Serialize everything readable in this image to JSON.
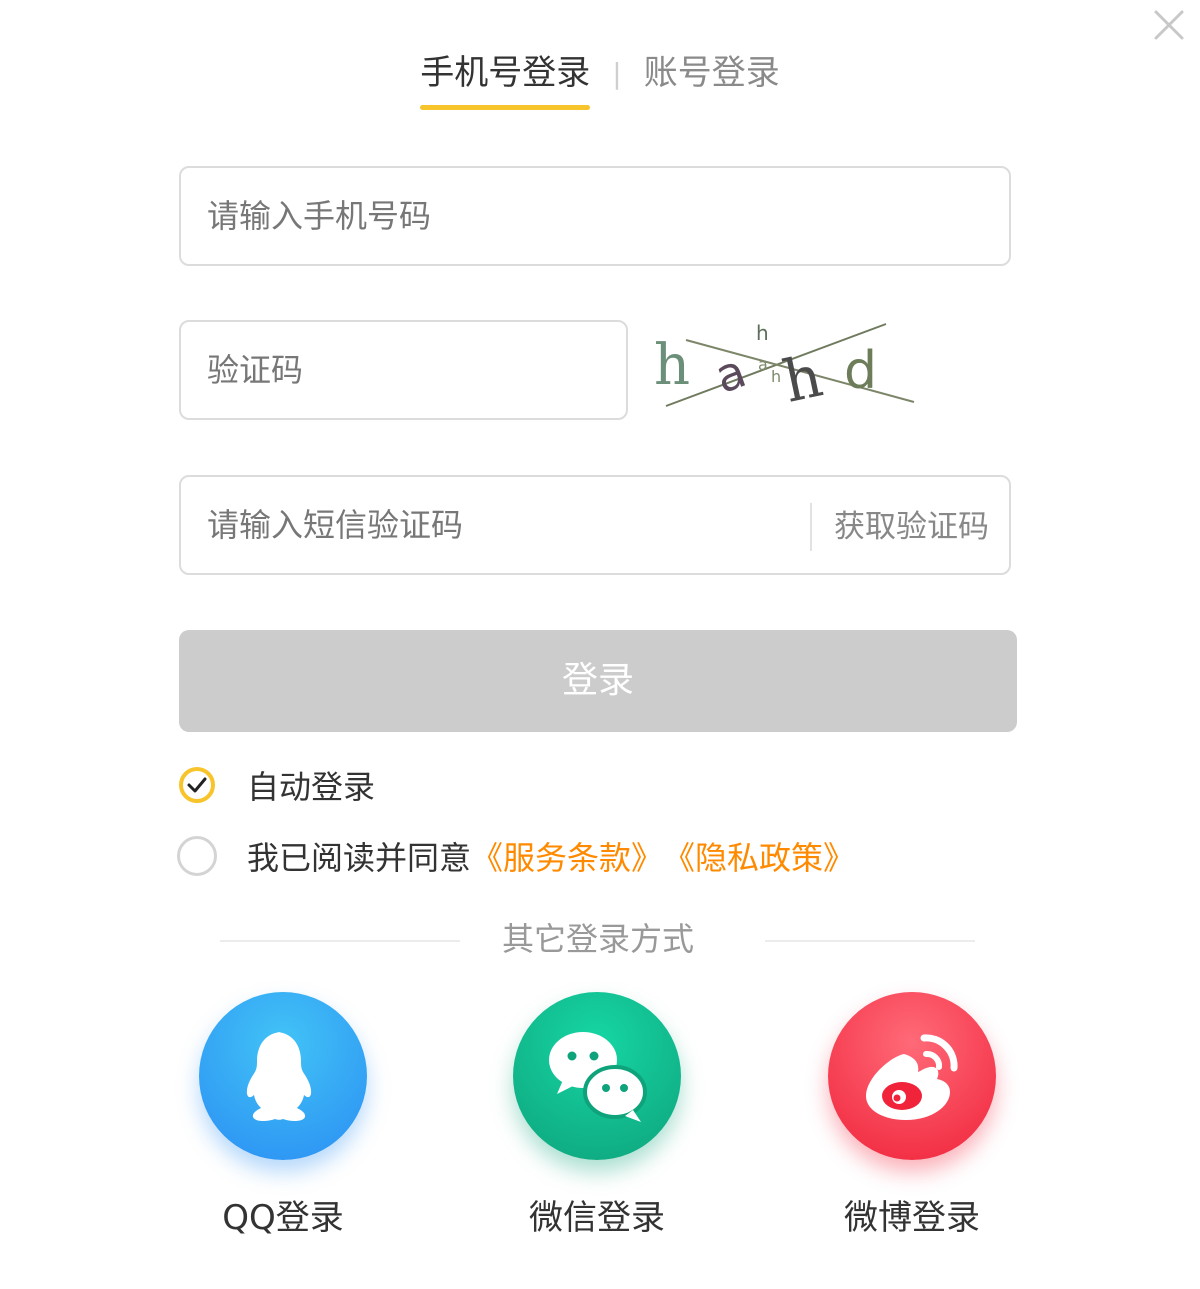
{
  "tabs": [
    {
      "label": "手机号登录",
      "active": true
    },
    {
      "label": "账号登录",
      "active": false
    }
  ],
  "tab_separator": "|",
  "form": {
    "phone_placeholder": "请输入手机号码",
    "captcha_placeholder": "验证码",
    "sms_placeholder": "请输入短信验证码",
    "get_code_label": "获取验证码",
    "captcha_text": "hahd",
    "login_label": "登录"
  },
  "options": {
    "auto_login_label": "自动登录",
    "auto_login_checked": true,
    "agree_label": "我已阅读并同意",
    "agree_checked": false,
    "terms_link": "《服务条款》",
    "privacy_link": "《隐私政策》"
  },
  "other_login": {
    "title": "其它登录方式",
    "providers": [
      {
        "label": "QQ登录",
        "icon": "qq-icon",
        "color": "#2a8ef3"
      },
      {
        "label": "微信登录",
        "icon": "wechat-icon",
        "color": "#0ea37b"
      },
      {
        "label": "微博登录",
        "icon": "weibo-icon",
        "color": "#f0233a"
      }
    ]
  },
  "colors": {
    "accent": "#f8c42b",
    "link": "#ff8a00",
    "button_disabled": "#cccccc"
  },
  "icons": {
    "close": "close-icon",
    "check": "check-icon"
  }
}
